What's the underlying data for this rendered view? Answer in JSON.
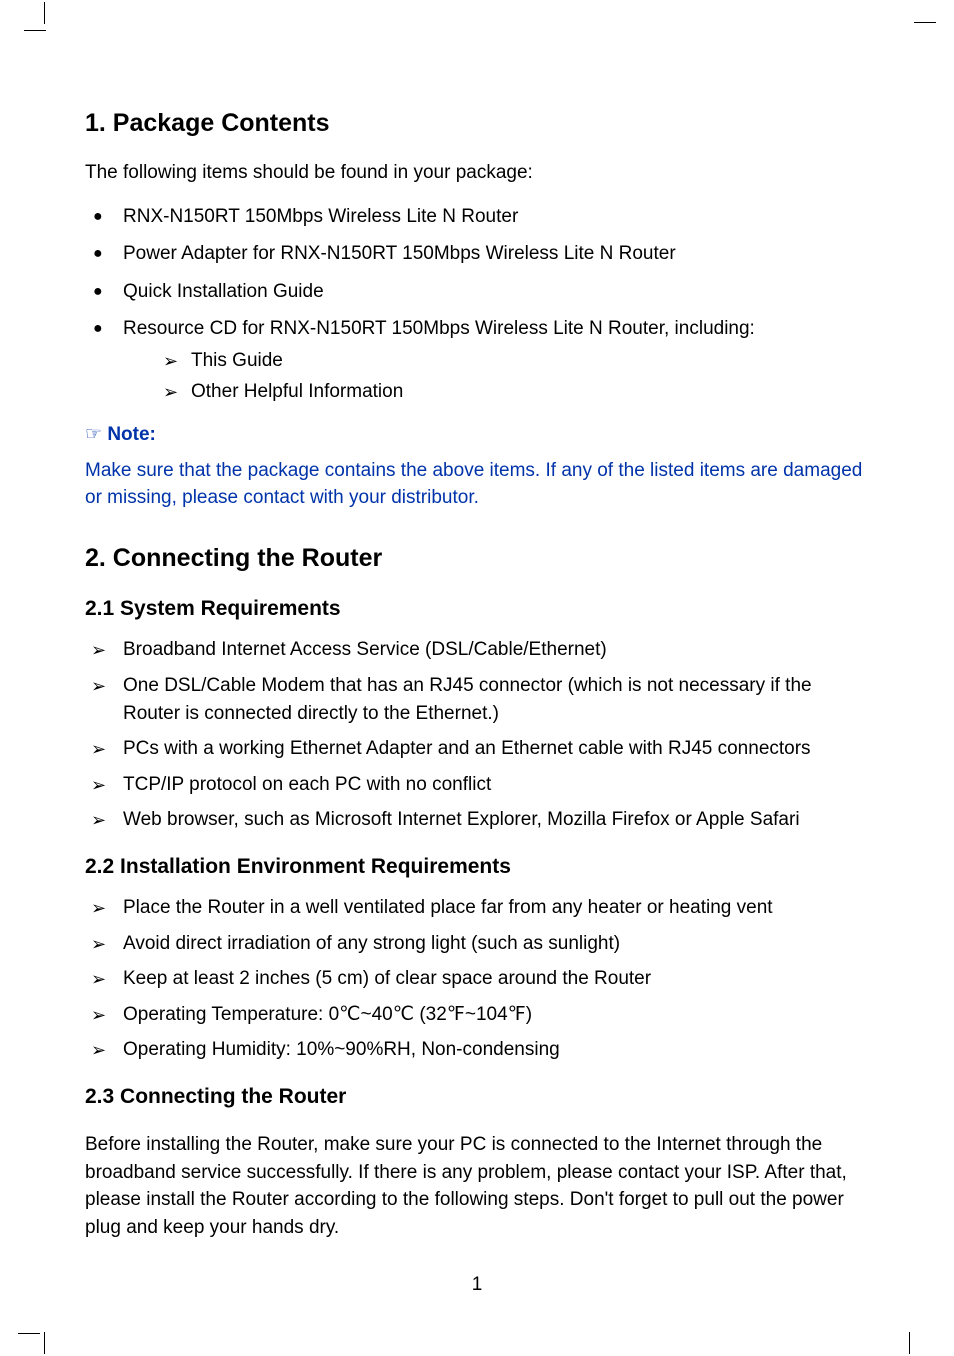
{
  "section1": {
    "heading": "1.  Package Contents",
    "intro": "The following items should be found in your package:",
    "items": [
      "RNX-N150RT 150Mbps Wireless Lite N Router",
      "Power Adapter for RNX-N150RT 150Mbps Wireless Lite N Router",
      "Quick Installation Guide",
      "Resource CD for RNX-N150RT 150Mbps Wireless Lite N Router, including:"
    ],
    "subitems": [
      "This Guide",
      "Other Helpful Information"
    ],
    "note_label": "Note:",
    "note_body": "Make sure that the package contains the above items. If any of the listed items are damaged or missing, please contact with your distributor."
  },
  "section2": {
    "heading": "2.  Connecting the Router",
    "sub1": {
      "heading": "2.1   System Requirements",
      "items": [
        "Broadband Internet Access Service (DSL/Cable/Ethernet)",
        "One DSL/Cable Modem that has an RJ45 connector (which is not necessary if the Router is connected directly to the Ethernet.)",
        "PCs with a working Ethernet Adapter and an Ethernet cable with RJ45 connectors",
        "TCP/IP protocol on each PC with no conflict",
        "Web browser, such as Microsoft Internet Explorer, Mozilla Firefox or Apple Safari"
      ]
    },
    "sub2": {
      "heading": "2.2   Installation Environment Requirements",
      "items": [
        "Place the Router in a well ventilated place far from any heater or heating vent",
        "Avoid direct irradiation of any strong light (such as sunlight)",
        "Keep at least 2 inches (5 cm) of clear space around the Router",
        "Operating Temperature: 0℃~40℃ (32℉~104℉)",
        "Operating Humidity: 10%~90%RH, Non-condensing"
      ]
    },
    "sub3": {
      "heading": "2.3   Connecting the Router",
      "body": "Before installing the Router, make sure your PC is connected to the Internet through the broadband service successfully. If there is any problem, please contact your ISP. After that, please install the Router according to the following steps. Don't forget to pull out the power plug and keep your hands dry."
    }
  },
  "page_number": "1"
}
